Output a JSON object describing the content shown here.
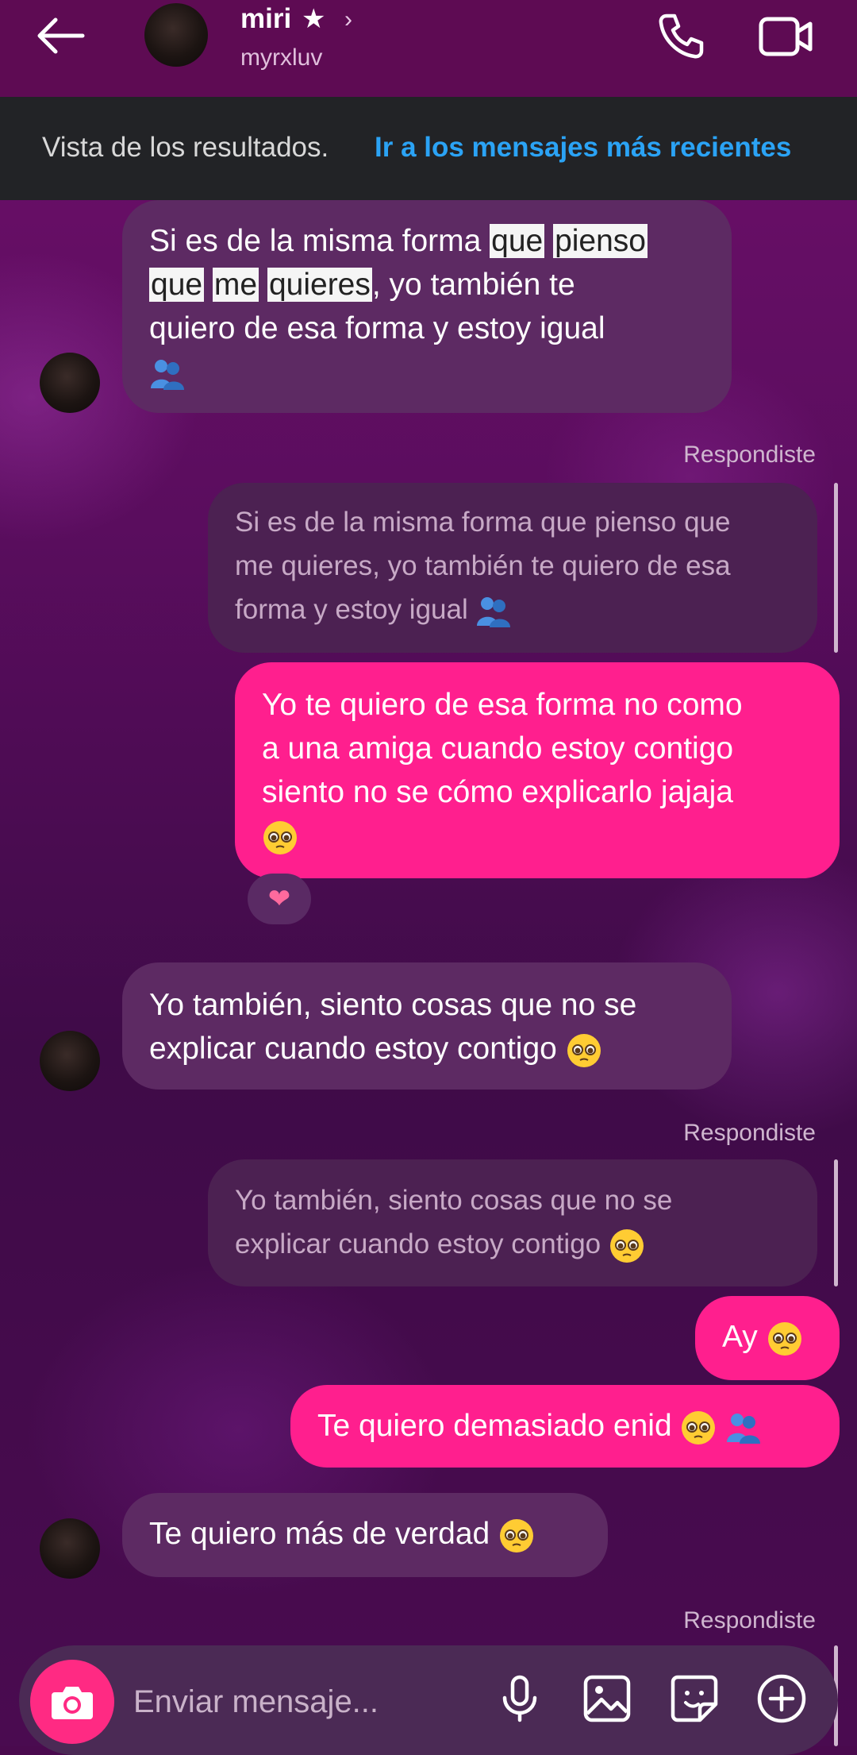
{
  "header": {
    "contact_name": "miri",
    "contact_star": "★",
    "contact_handle": "myrxluv",
    "chevron": "›"
  },
  "banner": {
    "text": "Vista de los resultados.",
    "link": "Ir a los mensajes más recientes"
  },
  "messages": {
    "m1": {
      "line1_a": "Si es de la misma forma ",
      "line1_h1": "que",
      "line1_h2": "pienso",
      "line2_h1": "que",
      "line2_h2": "me",
      "line2_h3": "quieres",
      "line2_b": ", yo también te",
      "line3": "quiero de esa forma y estoy igual"
    },
    "respond_1": "Respondiste",
    "q1": {
      "line1": "Si es de la misma forma que pienso que",
      "line2": "me quieres, yo también te quiero de esa",
      "line3": "forma y estoy igual"
    },
    "m2": {
      "line1": "Yo te quiero de esa forma no como",
      "line2": "a una amiga cuando estoy contigo",
      "line3": "siento no se cómo explicarlo jajaja"
    },
    "reaction": "❤",
    "m3": {
      "line1": "Yo también, siento cosas que no se",
      "line2": "explicar cuando estoy contigo"
    },
    "respond_2": "Respondiste",
    "q2": {
      "line1": "Yo también, siento cosas que no se",
      "line2": "explicar cuando estoy contigo"
    },
    "m4": "Ay",
    "m5": "Te quiero demasiado enid",
    "m6": "Te quiero más de verdad",
    "respond_3": "Respondiste"
  },
  "composer": {
    "placeholder": "Enviar mensaje..."
  },
  "icons": {
    "back": "back-arrow-icon",
    "phone": "phone-icon",
    "video": "video-camera-icon",
    "camera": "camera-icon",
    "mic": "microphone-icon",
    "gallery": "gallery-icon",
    "sticker": "sticker-icon",
    "plus": "plus-circle-icon"
  },
  "colors": {
    "header_bg": "#5e0b53",
    "banner_bg": "#222326",
    "banner_link": "#2ba3f5",
    "incoming_bubble": "#5d2a63",
    "outgoing_bubble": "#ff1f8e",
    "quote_bubble": "#4c2152",
    "camera_button": "#ff2a83"
  }
}
